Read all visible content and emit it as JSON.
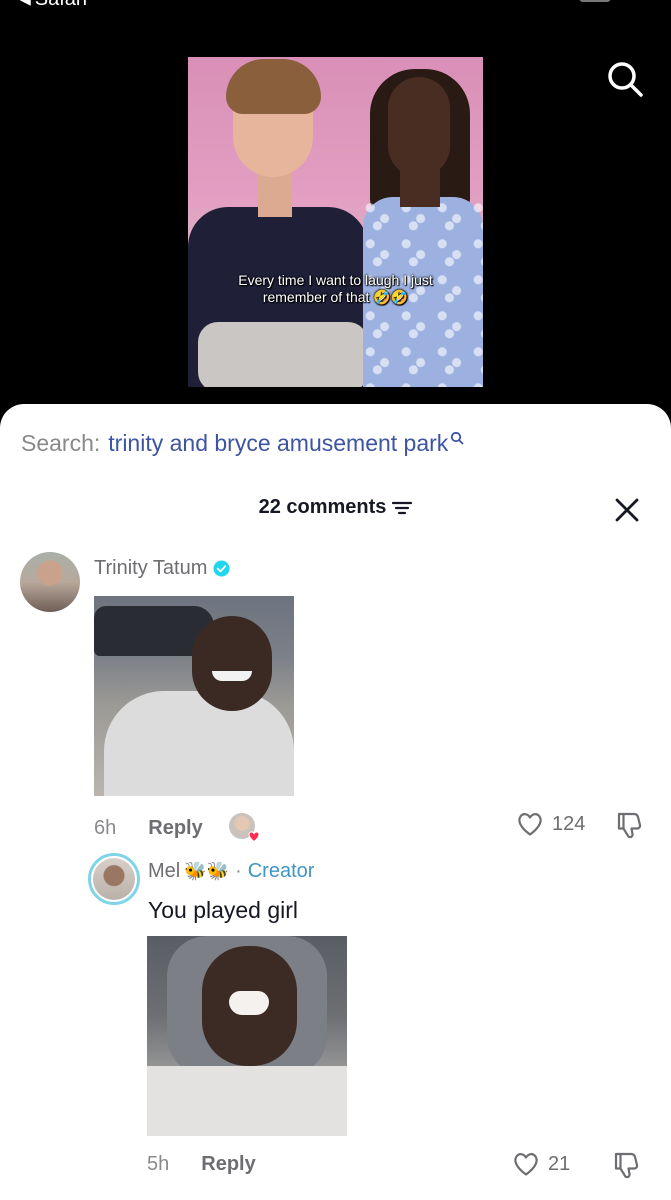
{
  "status_bar": {
    "back_label": "Safari"
  },
  "video": {
    "caption_line1": "Every time I want to laugh I just",
    "caption_line2": "remember of that 🤣🤣"
  },
  "search": {
    "prefix": "Search:",
    "term": "trinity and bryce amusement park"
  },
  "comments_panel": {
    "count_label": "22 comments"
  },
  "comments": [
    {
      "author": "Trinity Tatum",
      "verified": true,
      "time": "6h",
      "reply_label": "Reply",
      "likes": "124"
    }
  ],
  "replies": [
    {
      "author": "Mel",
      "author_emoji": "🐝🐝",
      "separator": "·",
      "tag": "Creator",
      "text": "You played girl",
      "time": "5h",
      "reply_label": "Reply",
      "likes": "21"
    }
  ],
  "colors": {
    "accent_search": "#3d54a3",
    "creator_tag": "#3f95c3",
    "verified": "#20d5ec",
    "muted_text": "#8a8a8e"
  },
  "icons": [
    "search-icon",
    "filter-icon",
    "close-icon",
    "verified-icon",
    "heart-icon",
    "dislike-icon"
  ]
}
